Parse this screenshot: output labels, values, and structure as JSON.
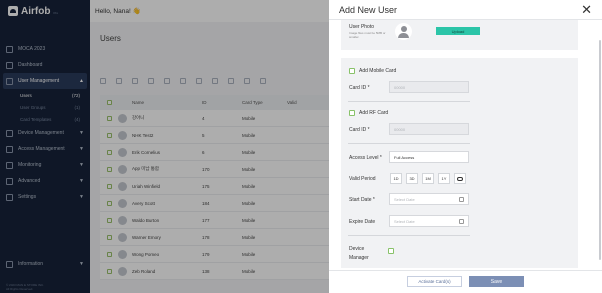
{
  "app": {
    "logo": "Airfob",
    "logo_sub": "Pro"
  },
  "header": {
    "greeting": "Hello, Nana! 👋"
  },
  "sidebar": {
    "items": [
      {
        "label": "MOCA 2023",
        "icon": "building-icon"
      },
      {
        "label": "Dashboard",
        "icon": "dashboard-icon"
      },
      {
        "label": "User Management",
        "icon": "users-icon",
        "active": true
      },
      {
        "label": "Device Management",
        "icon": "device-icon"
      },
      {
        "label": "Access Management",
        "icon": "lock-icon"
      },
      {
        "label": "Monitoring",
        "icon": "monitor-icon"
      },
      {
        "label": "Advanced",
        "icon": "advanced-icon"
      },
      {
        "label": "Settings",
        "icon": "gear-icon"
      }
    ],
    "sub_items": [
      {
        "label": "Users",
        "count": "(72)",
        "active": true
      },
      {
        "label": "User Groups",
        "count": "(1)"
      },
      {
        "label": "Card Templates",
        "count": "(4)"
      }
    ],
    "info": "Information",
    "footer": "© 2023 MAN E STORE INC.\nAll Rights Reserved."
  },
  "main": {
    "title": "Users",
    "columns": [
      "Name",
      "ID",
      "Card Type",
      "Valid"
    ],
    "rows": [
      {
        "name": "강아니",
        "id": "4",
        "type": "Mobile"
      },
      {
        "name": "NHK Test2",
        "id": "5",
        "type": "Mobile"
      },
      {
        "name": "Erik Cornelius",
        "id": "6",
        "type": "Mobile"
      },
      {
        "name": "App 미납 통합",
        "id": "170",
        "type": "Mobile"
      },
      {
        "name": "Uriah Winfield",
        "id": "175",
        "type": "Mobile"
      },
      {
        "name": "Avery Scott",
        "id": "184",
        "type": "Mobile"
      },
      {
        "name": "Waldo Burton",
        "id": "177",
        "type": "Mobile"
      },
      {
        "name": "Warner Emory",
        "id": "178",
        "type": "Mobile"
      },
      {
        "name": "Wong Pomeo",
        "id": "179",
        "type": "Mobile"
      },
      {
        "name": "Zeb Roland",
        "id": "138",
        "type": "Mobile"
      }
    ]
  },
  "modal": {
    "title": "Add New User",
    "photo_label": "User Photo",
    "photo_hint": "Image files must be 5MB or smaller.",
    "upload_label": "Upload",
    "mobile_card_label": "Add Mobile Card",
    "card_id_label": "Card ID *",
    "card_id_placeholder": "00000",
    "rf_card_label": "Add RF Card",
    "rf_card_id_label": "Card ID *",
    "rf_card_id_placeholder": "00000",
    "access_level_label": "Access Level *",
    "access_level_value": "Full Access",
    "valid_period_label": "Valid Period",
    "periods": [
      "1D",
      "3D",
      "1M",
      "1Y"
    ],
    "start_date_label": "Start Date *",
    "start_date_placeholder": "Select Date",
    "expire_date_label": "Expire Date",
    "expire_date_placeholder": "Select Date",
    "device_manager_label": "Device Manager",
    "activate_label": "Activate Card(s)",
    "save_label": "Save"
  },
  "colors": {
    "sidebar": "#17233a",
    "accent": "#2cc5a8",
    "save": "#7c8fb5"
  }
}
